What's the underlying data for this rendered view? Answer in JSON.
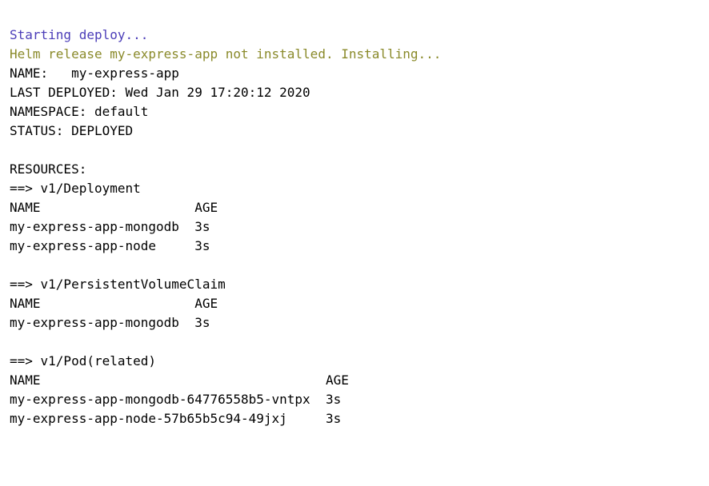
{
  "lines": {
    "l1": "Starting deploy...",
    "l2": "Helm release my-express-app not installed. Installing...",
    "l3": "NAME:   my-express-app",
    "l4": "LAST DEPLOYED: Wed Jan 29 17:20:12 2020",
    "l5": "NAMESPACE: default",
    "l6": "STATUS: DEPLOYED",
    "blank": "",
    "l7": "RESOURCES:",
    "l8": "==> v1/Deployment",
    "l9": "NAME                    AGE",
    "l10": "my-express-app-mongodb  3s",
    "l11": "my-express-app-node     3s",
    "l12": "==> v1/PersistentVolumeClaim",
    "l13": "NAME                    AGE",
    "l14": "my-express-app-mongodb  3s",
    "l15": "==> v1/Pod(related)",
    "l16": "NAME                                     AGE",
    "l17": "my-express-app-mongodb-64776558b5-vntpx  3s",
    "l18": "my-express-app-node-57b65b5c94-49jxj     3s"
  }
}
